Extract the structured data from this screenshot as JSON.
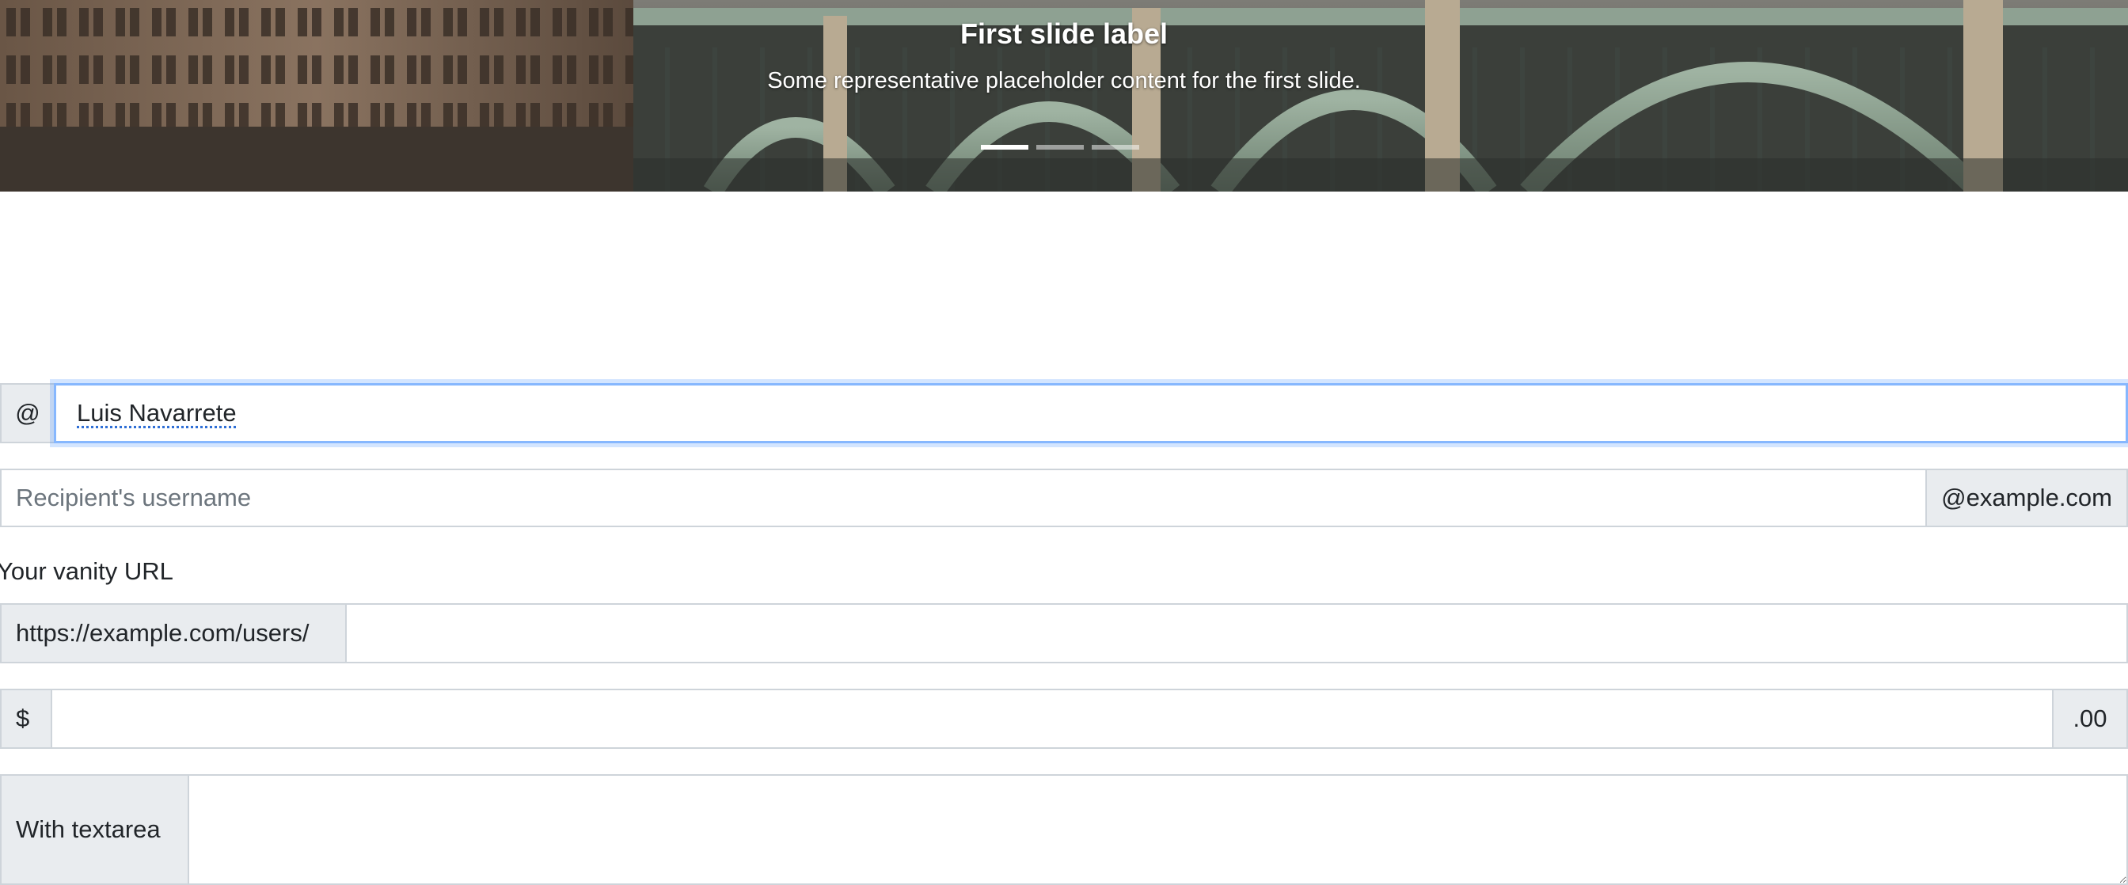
{
  "carousel": {
    "caption_title": "First slide label",
    "caption_text": "Some representative placeholder content for the first slide.",
    "indicators": [
      "slide-1",
      "slide-2",
      "slide-3"
    ],
    "active_index": 0
  },
  "username_group": {
    "addon": "@",
    "value": "Luis Navarrete"
  },
  "recipient_group": {
    "placeholder": "Recipient's username",
    "addon": "@example.com"
  },
  "vanity": {
    "label": "Your vanity URL",
    "addon": "https://example.com/users/",
    "value": ""
  },
  "amount_group": {
    "prefix": "$",
    "suffix": ".00",
    "value": ""
  },
  "textarea_group": {
    "addon": "With textarea",
    "value": ""
  },
  "colors": {
    "addon_bg": "#e9ecef",
    "border": "#ced4da",
    "focus_border": "#86b7fe",
    "text": "#212529",
    "placeholder": "#6c757d"
  }
}
